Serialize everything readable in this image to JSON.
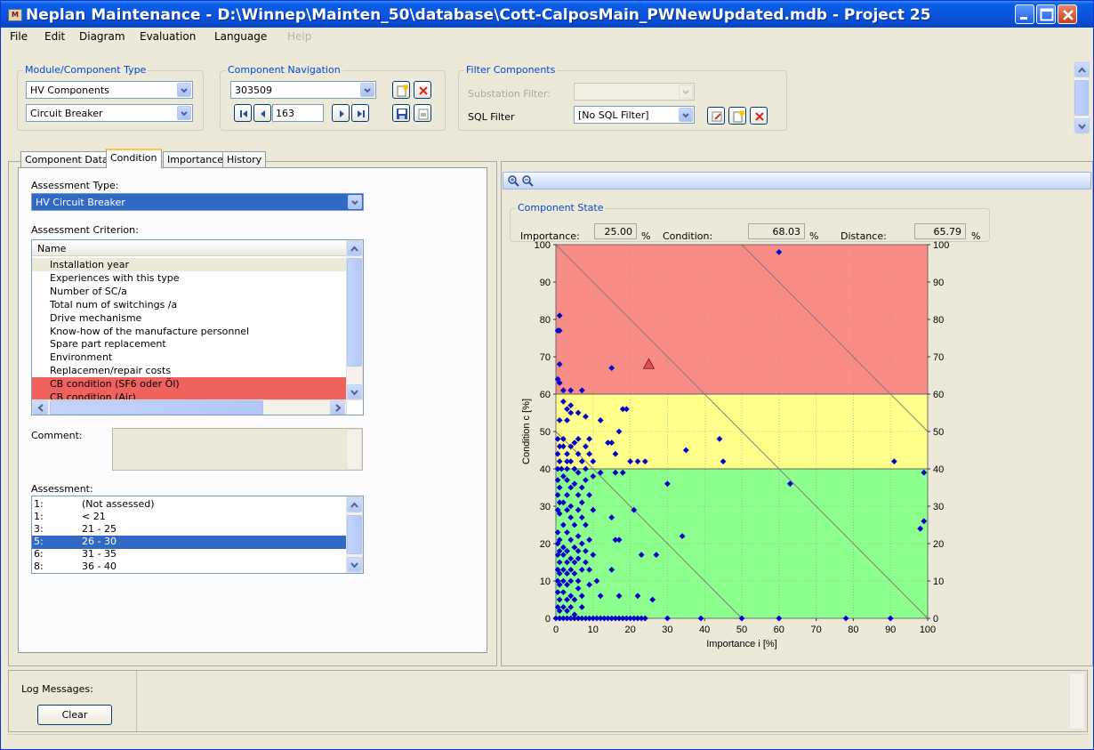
{
  "app": {
    "icon_text": "M",
    "title": "Neplan Maintenance - D:\\Winnep\\Mainten_50\\database\\Cott-CalposMain_PWNewUpdated.mdb - Project 25"
  },
  "menu": {
    "items": [
      "File",
      "Edit",
      "Diagram",
      "Evaluation",
      "Language",
      "Help"
    ],
    "disabled": [
      "Help"
    ]
  },
  "module_group": {
    "label": "Module/Component Type",
    "module_value": "HV Components",
    "type_value": "Circuit Breaker"
  },
  "nav_group": {
    "label": "Component Navigation",
    "component_id": "303509",
    "index": "163"
  },
  "filter_group": {
    "label": "Filter Components",
    "substation_label": "Substation Filter:",
    "substation_value": "",
    "sql_label": "SQL Filter",
    "sql_value": "[No SQL Filter]"
  },
  "tabs": [
    "Component Data",
    "Condition",
    "Importance",
    "History"
  ],
  "active_tab": "Condition",
  "condition": {
    "assessment_type_label": "Assessment Type:",
    "assessment_type_value": "HV Circuit Breaker",
    "criterion_label": "Assessment Criterion:",
    "criterion_header": "Name",
    "criteria": [
      {
        "name": "Installation year",
        "state": "first"
      },
      {
        "name": "Experiences with this type",
        "state": ""
      },
      {
        "name": "Number of SC/a",
        "state": ""
      },
      {
        "name": "Total num of switchings /a",
        "state": ""
      },
      {
        "name": "Drive mechanisme",
        "state": ""
      },
      {
        "name": "Know-how of the manufacture personnel",
        "state": ""
      },
      {
        "name": "Spare part replacement",
        "state": ""
      },
      {
        "name": "Environment",
        "state": ""
      },
      {
        "name": "Replacemen/repair costs",
        "state": ""
      },
      {
        "name": "CB condition (SF6 oder Öl)",
        "state": "red"
      },
      {
        "name": "CB condition (Air)",
        "state": "red"
      }
    ],
    "comment_label": "Comment:",
    "comment_value": "",
    "assessment_label": "Assessment:",
    "assessments": [
      {
        "num": "1:",
        "text": "(Not assessed)",
        "selected": false
      },
      {
        "num": "1:",
        "text": "< 21",
        "selected": false
      },
      {
        "num": "3:",
        "text": "21 - 25",
        "selected": false
      },
      {
        "num": "5:",
        "text": "26 - 30",
        "selected": true
      },
      {
        "num": "6:",
        "text": "31 - 35",
        "selected": false
      },
      {
        "num": "8:",
        "text": "36 - 40",
        "selected": false
      }
    ]
  },
  "component_state": {
    "label": "Component State",
    "importance_label": "Importance:",
    "importance_value": "25.00",
    "condition_label": "Condition:",
    "condition_value": "68.03",
    "distance_label": "Distance:",
    "distance_value": "65.79",
    "unit": "%"
  },
  "log": {
    "label": "Log Messages:",
    "clear_label": "Clear"
  },
  "colors": {
    "red_zone": "#fa8c87",
    "yellow_zone": "#ffff8c",
    "green_zone": "#8cff8c",
    "points": "#0000cc",
    "selected_point": "#e05050",
    "selection": "#316ac5",
    "titlebar": "#0a53dc"
  },
  "chart_data": {
    "type": "scatter",
    "title": "",
    "xlabel": "Importance i [%]",
    "ylabel": "Condition c [%]",
    "xlim": [
      0,
      100
    ],
    "ylim": [
      0,
      100
    ],
    "x_ticks": [
      0,
      10,
      20,
      30,
      40,
      50,
      60,
      70,
      80,
      90,
      100
    ],
    "y_ticks": [
      0,
      10,
      20,
      30,
      40,
      50,
      60,
      70,
      80,
      90,
      100
    ],
    "zones": [
      {
        "name": "red",
        "from": 60,
        "to": 100
      },
      {
        "name": "yellow",
        "from": 40,
        "to": 60
      },
      {
        "name": "green",
        "from": 0,
        "to": 40
      }
    ],
    "diagonals": [
      50,
      100,
      150
    ],
    "selected": {
      "x": 25,
      "y": 68.03
    },
    "points": [
      [
        60,
        98
      ],
      [
        1,
        81
      ],
      [
        1,
        77
      ],
      [
        0.5,
        77
      ],
      [
        1,
        68
      ],
      [
        15,
        67
      ],
      [
        1,
        63
      ],
      [
        0.5,
        64
      ],
      [
        2,
        61
      ],
      [
        4,
        61
      ],
      [
        7,
        61
      ],
      [
        2,
        58
      ],
      [
        4,
        57
      ],
      [
        3,
        56
      ],
      [
        6,
        55
      ],
      [
        4,
        55
      ],
      [
        1,
        53
      ],
      [
        3,
        53
      ],
      [
        18,
        56
      ],
      [
        19,
        56
      ],
      [
        8,
        54
      ],
      [
        12,
        53
      ],
      [
        17,
        50
      ],
      [
        0.5,
        48
      ],
      [
        2,
        48
      ],
      [
        5,
        47
      ],
      [
        6,
        48
      ],
      [
        9,
        48
      ],
      [
        44,
        48
      ],
      [
        14,
        47
      ],
      [
        15,
        47
      ],
      [
        1,
        46
      ],
      [
        2,
        46
      ],
      [
        4,
        46
      ],
      [
        8,
        46
      ],
      [
        0.5,
        44
      ],
      [
        3,
        44
      ],
      [
        6,
        44
      ],
      [
        9,
        44
      ],
      [
        16,
        44
      ],
      [
        35,
        45
      ],
      [
        1,
        42
      ],
      [
        3,
        42
      ],
      [
        4,
        42
      ],
      [
        7,
        42
      ],
      [
        10,
        42
      ],
      [
        20,
        42
      ],
      [
        22,
        42
      ],
      [
        24,
        42
      ],
      [
        45,
        42
      ],
      [
        91,
        42
      ],
      [
        0.5,
        40
      ],
      [
        1.5,
        40
      ],
      [
        3,
        40
      ],
      [
        5,
        40
      ],
      [
        6,
        39
      ],
      [
        8,
        40
      ],
      [
        12,
        39
      ],
      [
        16,
        39
      ],
      [
        18,
        39
      ],
      [
        99,
        39
      ],
      [
        0.5,
        37
      ],
      [
        2,
        38
      ],
      [
        3,
        37
      ],
      [
        5,
        36
      ],
      [
        8,
        37
      ],
      [
        10,
        38
      ],
      [
        1,
        35
      ],
      [
        4,
        35
      ],
      [
        7,
        35
      ],
      [
        30,
        36
      ],
      [
        63,
        36
      ],
      [
        0.5,
        33
      ],
      [
        3,
        33
      ],
      [
        6,
        33
      ],
      [
        9,
        33
      ],
      [
        1,
        31
      ],
      [
        2,
        31
      ],
      [
        4,
        30
      ],
      [
        7,
        31
      ],
      [
        0.5,
        29
      ],
      [
        3,
        29
      ],
      [
        6,
        29
      ],
      [
        10,
        29
      ],
      [
        21,
        29
      ],
      [
        1,
        28
      ],
      [
        4,
        27
      ],
      [
        7,
        27
      ],
      [
        15,
        27
      ],
      [
        2,
        25
      ],
      [
        5,
        25
      ],
      [
        8,
        25
      ],
      [
        0.5,
        23
      ],
      [
        3,
        23
      ],
      [
        6,
        22
      ],
      [
        34,
        22
      ],
      [
        99,
        26
      ],
      [
        98,
        24
      ],
      [
        1,
        21
      ],
      [
        4,
        21
      ],
      [
        9,
        21
      ],
      [
        16,
        21
      ],
      [
        17,
        21
      ],
      [
        0.5,
        20
      ],
      [
        2,
        19
      ],
      [
        5,
        19
      ],
      [
        7,
        20
      ],
      [
        1,
        18
      ],
      [
        3,
        18
      ],
      [
        6,
        18
      ],
      [
        8,
        18
      ],
      [
        0.5,
        17
      ],
      [
        2,
        17
      ],
      [
        4,
        16
      ],
      [
        6,
        16
      ],
      [
        10,
        17
      ],
      [
        23,
        17
      ],
      [
        27,
        17
      ],
      [
        1,
        15
      ],
      [
        3,
        15
      ],
      [
        5,
        15
      ],
      [
        8,
        15
      ],
      [
        0.5,
        13
      ],
      [
        2,
        13
      ],
      [
        4,
        13
      ],
      [
        7,
        13
      ],
      [
        9,
        13
      ],
      [
        1,
        12
      ],
      [
        3,
        12
      ],
      [
        5,
        12
      ],
      [
        15,
        13
      ],
      [
        0.5,
        10
      ],
      [
        2,
        10
      ],
      [
        4,
        10
      ],
      [
        6,
        10
      ],
      [
        11,
        10
      ],
      [
        1,
        9
      ],
      [
        3,
        9
      ],
      [
        6,
        8
      ],
      [
        9,
        9
      ],
      [
        0.5,
        7
      ],
      [
        2,
        7
      ],
      [
        4,
        6
      ],
      [
        7,
        6
      ],
      [
        1,
        5
      ],
      [
        3,
        5
      ],
      [
        5,
        5
      ],
      [
        12,
        6
      ],
      [
        17,
        6
      ],
      [
        22,
        6
      ],
      [
        26,
        5
      ],
      [
        0.5,
        3
      ],
      [
        2,
        3
      ],
      [
        4,
        3
      ],
      [
        7,
        3
      ],
      [
        1,
        2
      ],
      [
        3,
        2
      ],
      [
        5,
        1
      ]
    ],
    "baseline_points": [
      0,
      1,
      2,
      3,
      4,
      5,
      6,
      7,
      8,
      9,
      10,
      11,
      12,
      13,
      14,
      15,
      16,
      17,
      18,
      19,
      20,
      21,
      22,
      23,
      24,
      30,
      39,
      50,
      60,
      78,
      90
    ]
  }
}
